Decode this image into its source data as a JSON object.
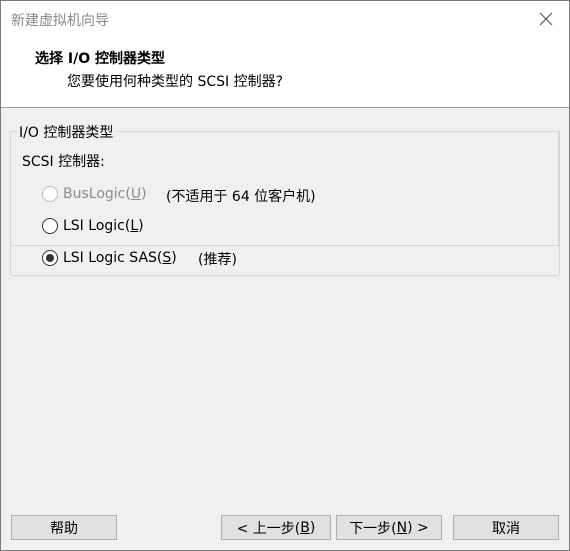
{
  "window": {
    "title": "新建虚拟机向导",
    "close_icon": "close-icon"
  },
  "header": {
    "title": "选择 I/O 控制器类型",
    "subtitle": "您要使用何种类型的 SCSI 控制器?"
  },
  "group": {
    "legend": "I/O 控制器类型",
    "scsi_label": "SCSI 控制器:",
    "options": [
      {
        "label": "BusLogic(",
        "mnemonic": "U",
        "suffix": ")",
        "note": "(不适用于 64 位客户机)",
        "selected": false,
        "enabled": false
      },
      {
        "label": "LSI Logic(",
        "mnemonic": "L",
        "suffix": ")",
        "note": "",
        "selected": false,
        "enabled": true
      },
      {
        "label": "LSI Logic SAS(",
        "mnemonic": "S",
        "suffix": ")",
        "note": "(推荐)",
        "selected": true,
        "enabled": true
      }
    ]
  },
  "footer": {
    "help": "帮助",
    "back": {
      "label": "< 上一步(",
      "mnemonic": "B",
      "suffix": ")"
    },
    "next": {
      "label": "下一步(",
      "mnemonic": "N",
      "suffix": ") >"
    },
    "cancel": "取消"
  }
}
